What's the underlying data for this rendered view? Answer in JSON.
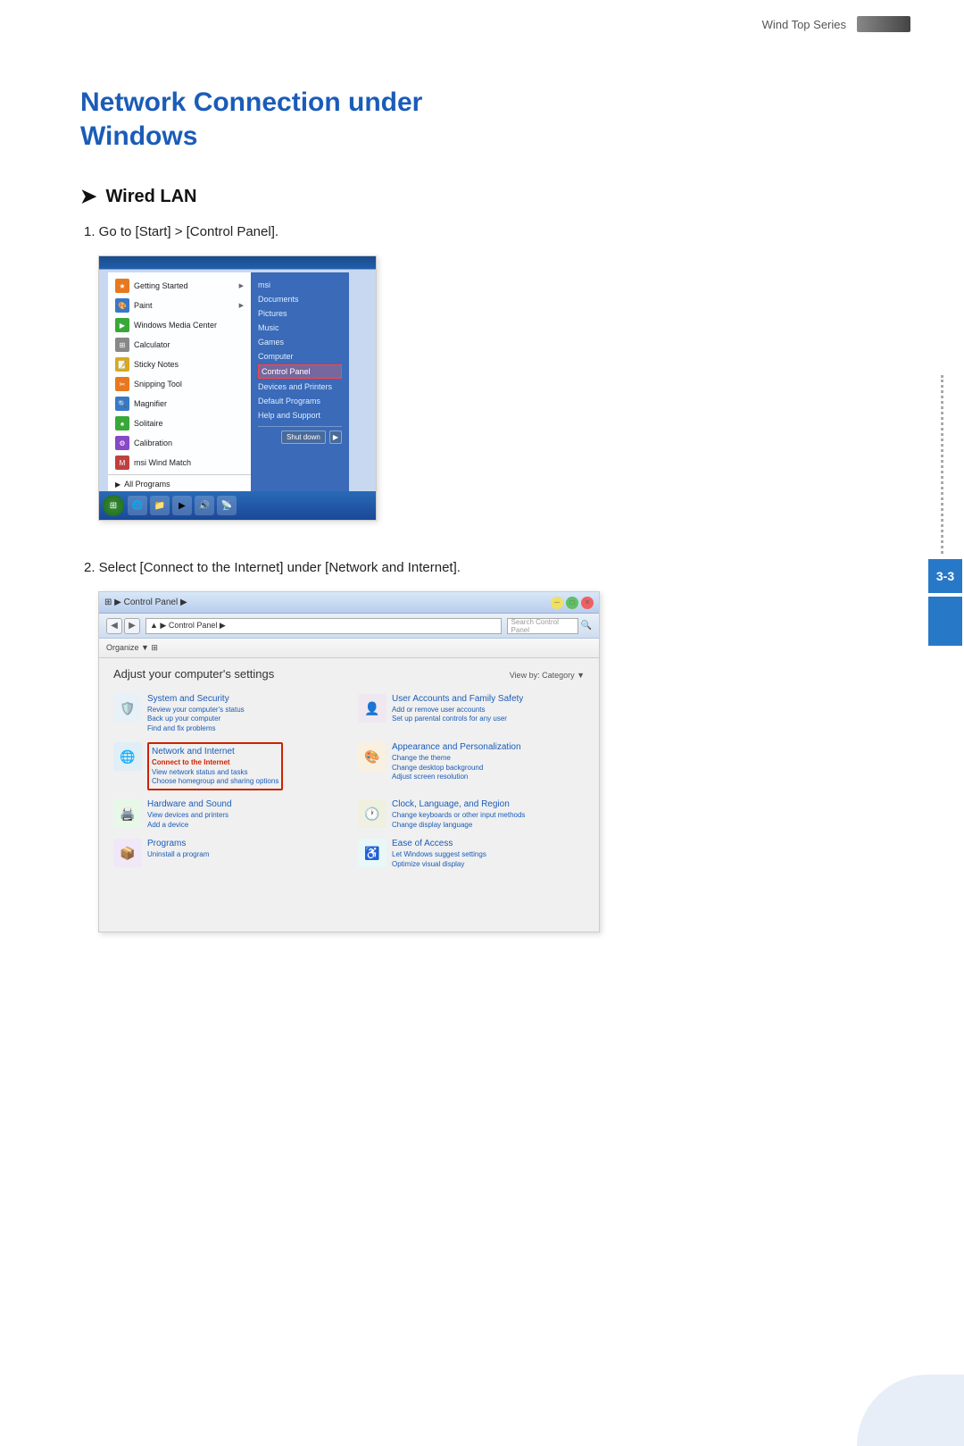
{
  "header": {
    "series_label": "Wind Top Series"
  },
  "page": {
    "title_line1": "Network Connection under",
    "title_line2": "Windows",
    "section1_heading": "Wired LAN",
    "step1_text": "1.  Go to [Start] > [Control Panel].",
    "step2_text": "2.  Select [Connect to the Internet] under [Network and Internet].",
    "page_number": "3-3"
  },
  "start_menu": {
    "left_items": [
      {
        "label": "Getting Started",
        "arrow": true
      },
      {
        "label": "Paint",
        "arrow": true
      },
      {
        "label": "Windows Media Center"
      },
      {
        "label": "Calculator"
      },
      {
        "label": "Sticky Notes"
      },
      {
        "label": "Snipping Tool"
      },
      {
        "label": "Magnifier"
      },
      {
        "label": "Solitaire"
      },
      {
        "label": "Calibration"
      },
      {
        "label": "msi Wind Match"
      },
      {
        "label": "All Programs",
        "arrow_left": true
      }
    ],
    "right_items": [
      {
        "label": "msi",
        "highlighted": false
      },
      {
        "label": "Documents"
      },
      {
        "label": "Pictures"
      },
      {
        "label": "Music"
      },
      {
        "label": "Games"
      },
      {
        "label": "Computer"
      },
      {
        "label": "Control Panel",
        "highlighted": true
      },
      {
        "label": "Devices and Printers"
      },
      {
        "label": "Default Programs"
      },
      {
        "label": "Help and Support"
      }
    ],
    "search_placeholder": "",
    "shutdown_label": "Shut down"
  },
  "control_panel": {
    "title": "Control Panel",
    "address_bar": "▲ ▶ Control Panel ▶",
    "search_placeholder": "Search Control Panel",
    "adjust_text": "Adjust your computer's settings",
    "view_by": "View by:  Category ▼",
    "sections": [
      {
        "title": "System and Security",
        "links": [
          "Review your computer's status",
          "Back up your computer",
          "Find and fix problems"
        ]
      },
      {
        "title": "User Accounts and Family Safety",
        "links": [
          "Add or remove user accounts",
          "Set up parental controls for any user"
        ]
      },
      {
        "title": "Network and Internet",
        "links": [
          "Connect to the Internet",
          "View network status and tasks",
          "Choose homegroup and sharing options"
        ],
        "highlighted": true
      },
      {
        "title": "Appearance and Personalization",
        "links": [
          "Change the theme",
          "Change desktop background",
          "Adjust screen resolution"
        ]
      },
      {
        "title": "Hardware and Sound",
        "links": [
          "View devices and printers",
          "Add a device"
        ]
      },
      {
        "title": "Clock, Language, and Region",
        "links": [
          "Change keyboards or other input methods",
          "Change display language"
        ]
      },
      {
        "title": "Programs",
        "links": [
          "Uninstall a program"
        ]
      },
      {
        "title": "Ease of Access",
        "links": [
          "Let Windows suggest settings",
          "Optimize visual display"
        ]
      }
    ]
  }
}
